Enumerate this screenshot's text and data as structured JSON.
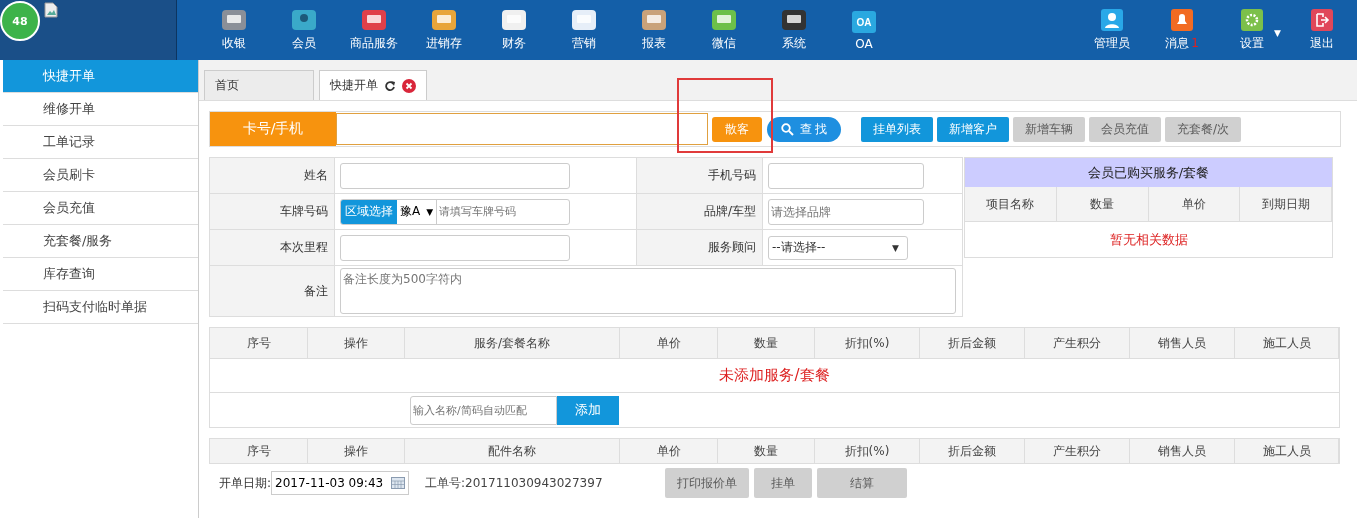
{
  "logo": {
    "badge": "48"
  },
  "top_nav": [
    {
      "label": "收银"
    },
    {
      "label": "会员"
    },
    {
      "label": "商品服务"
    },
    {
      "label": "进销存"
    },
    {
      "label": "财务"
    },
    {
      "label": "营销"
    },
    {
      "label": "报表"
    },
    {
      "label": "微信"
    },
    {
      "label": "系统"
    },
    {
      "label": "OA",
      "icon_text": "OA"
    }
  ],
  "user_menu": [
    {
      "label": "管理员"
    },
    {
      "label": "消息",
      "badge": "1"
    },
    {
      "label": "设置",
      "caret": "▼"
    },
    {
      "label": "退出"
    }
  ],
  "sidebar": {
    "items": [
      {
        "label": "快捷开单",
        "selected": true
      },
      {
        "label": "维修开单",
        "selected": false
      },
      {
        "label": "工单记录",
        "selected": false
      },
      {
        "label": "会员刷卡",
        "selected": false
      },
      {
        "label": "会员充值",
        "selected": false
      },
      {
        "label": "充套餐/服务",
        "selected": false
      },
      {
        "label": "库存查询",
        "selected": false
      },
      {
        "label": "扫码支付临时单据",
        "selected": false
      }
    ]
  },
  "tabs": [
    {
      "label": "首页",
      "selected": false,
      "closable": false
    },
    {
      "label": "快捷开单",
      "selected": true,
      "closable": true
    }
  ],
  "search": {
    "label": "卡号/手机",
    "walk_in_button": "散客",
    "find_button": "查 找"
  },
  "actions": [
    {
      "label": "挂单列表",
      "disabled": false
    },
    {
      "label": "新增客户",
      "disabled": false
    },
    {
      "label": "新增车辆",
      "disabled": true
    },
    {
      "label": "会员充值",
      "disabled": true
    },
    {
      "label": "充套餐/次",
      "disabled": true
    }
  ],
  "form": {
    "fields": [
      {
        "label": "姓名",
        "kind": "text"
      },
      {
        "label": "手机号码",
        "kind": "text"
      },
      {
        "label": "车牌号码",
        "kind": "plate",
        "region_button": "区域选择",
        "province": "豫A",
        "caret": "▼",
        "placeholder": "请填写车牌号码"
      },
      {
        "label": "品牌/车型",
        "kind": "text",
        "placeholder": "请选择品牌"
      },
      {
        "label": "本次里程",
        "kind": "text"
      },
      {
        "label": "服务顾问",
        "kind": "select",
        "value": "--请选择--",
        "caret": "▼"
      },
      {
        "label": "备注",
        "kind": "textarea",
        "placeholder": "备注长度为500字符内"
      }
    ]
  },
  "member_packages": {
    "title": "会员已购买服务/套餐",
    "columns": [
      "项目名称",
      "数量",
      "单价",
      "到期日期"
    ],
    "empty_text": "暂无相关数据"
  },
  "services_table": {
    "columns": [
      "序号",
      "操作",
      "服务/套餐名称",
      "单价",
      "数量",
      "折扣(%)",
      "折后金额",
      "产生积分",
      "销售人员",
      "施工人员"
    ],
    "empty_text": "未添加服务/套餐",
    "add_placeholder": "输入名称/简码自动匹配",
    "add_button": "添加"
  },
  "parts_table": {
    "columns": [
      "序号",
      "操作",
      "配件名称",
      "单价",
      "数量",
      "折扣(%)",
      "折后金额",
      "产生积分",
      "销售人员",
      "施工人员"
    ]
  },
  "footer": {
    "date_label": "开单日期:",
    "date_value": "2017-11-03 09:43",
    "order_no": "工单号:201711030943027397",
    "buttons": [
      {
        "label": "打印报价单",
        "disabled": true
      },
      {
        "label": "挂单",
        "disabled": true
      },
      {
        "label": "结算",
        "disabled": true
      }
    ]
  }
}
